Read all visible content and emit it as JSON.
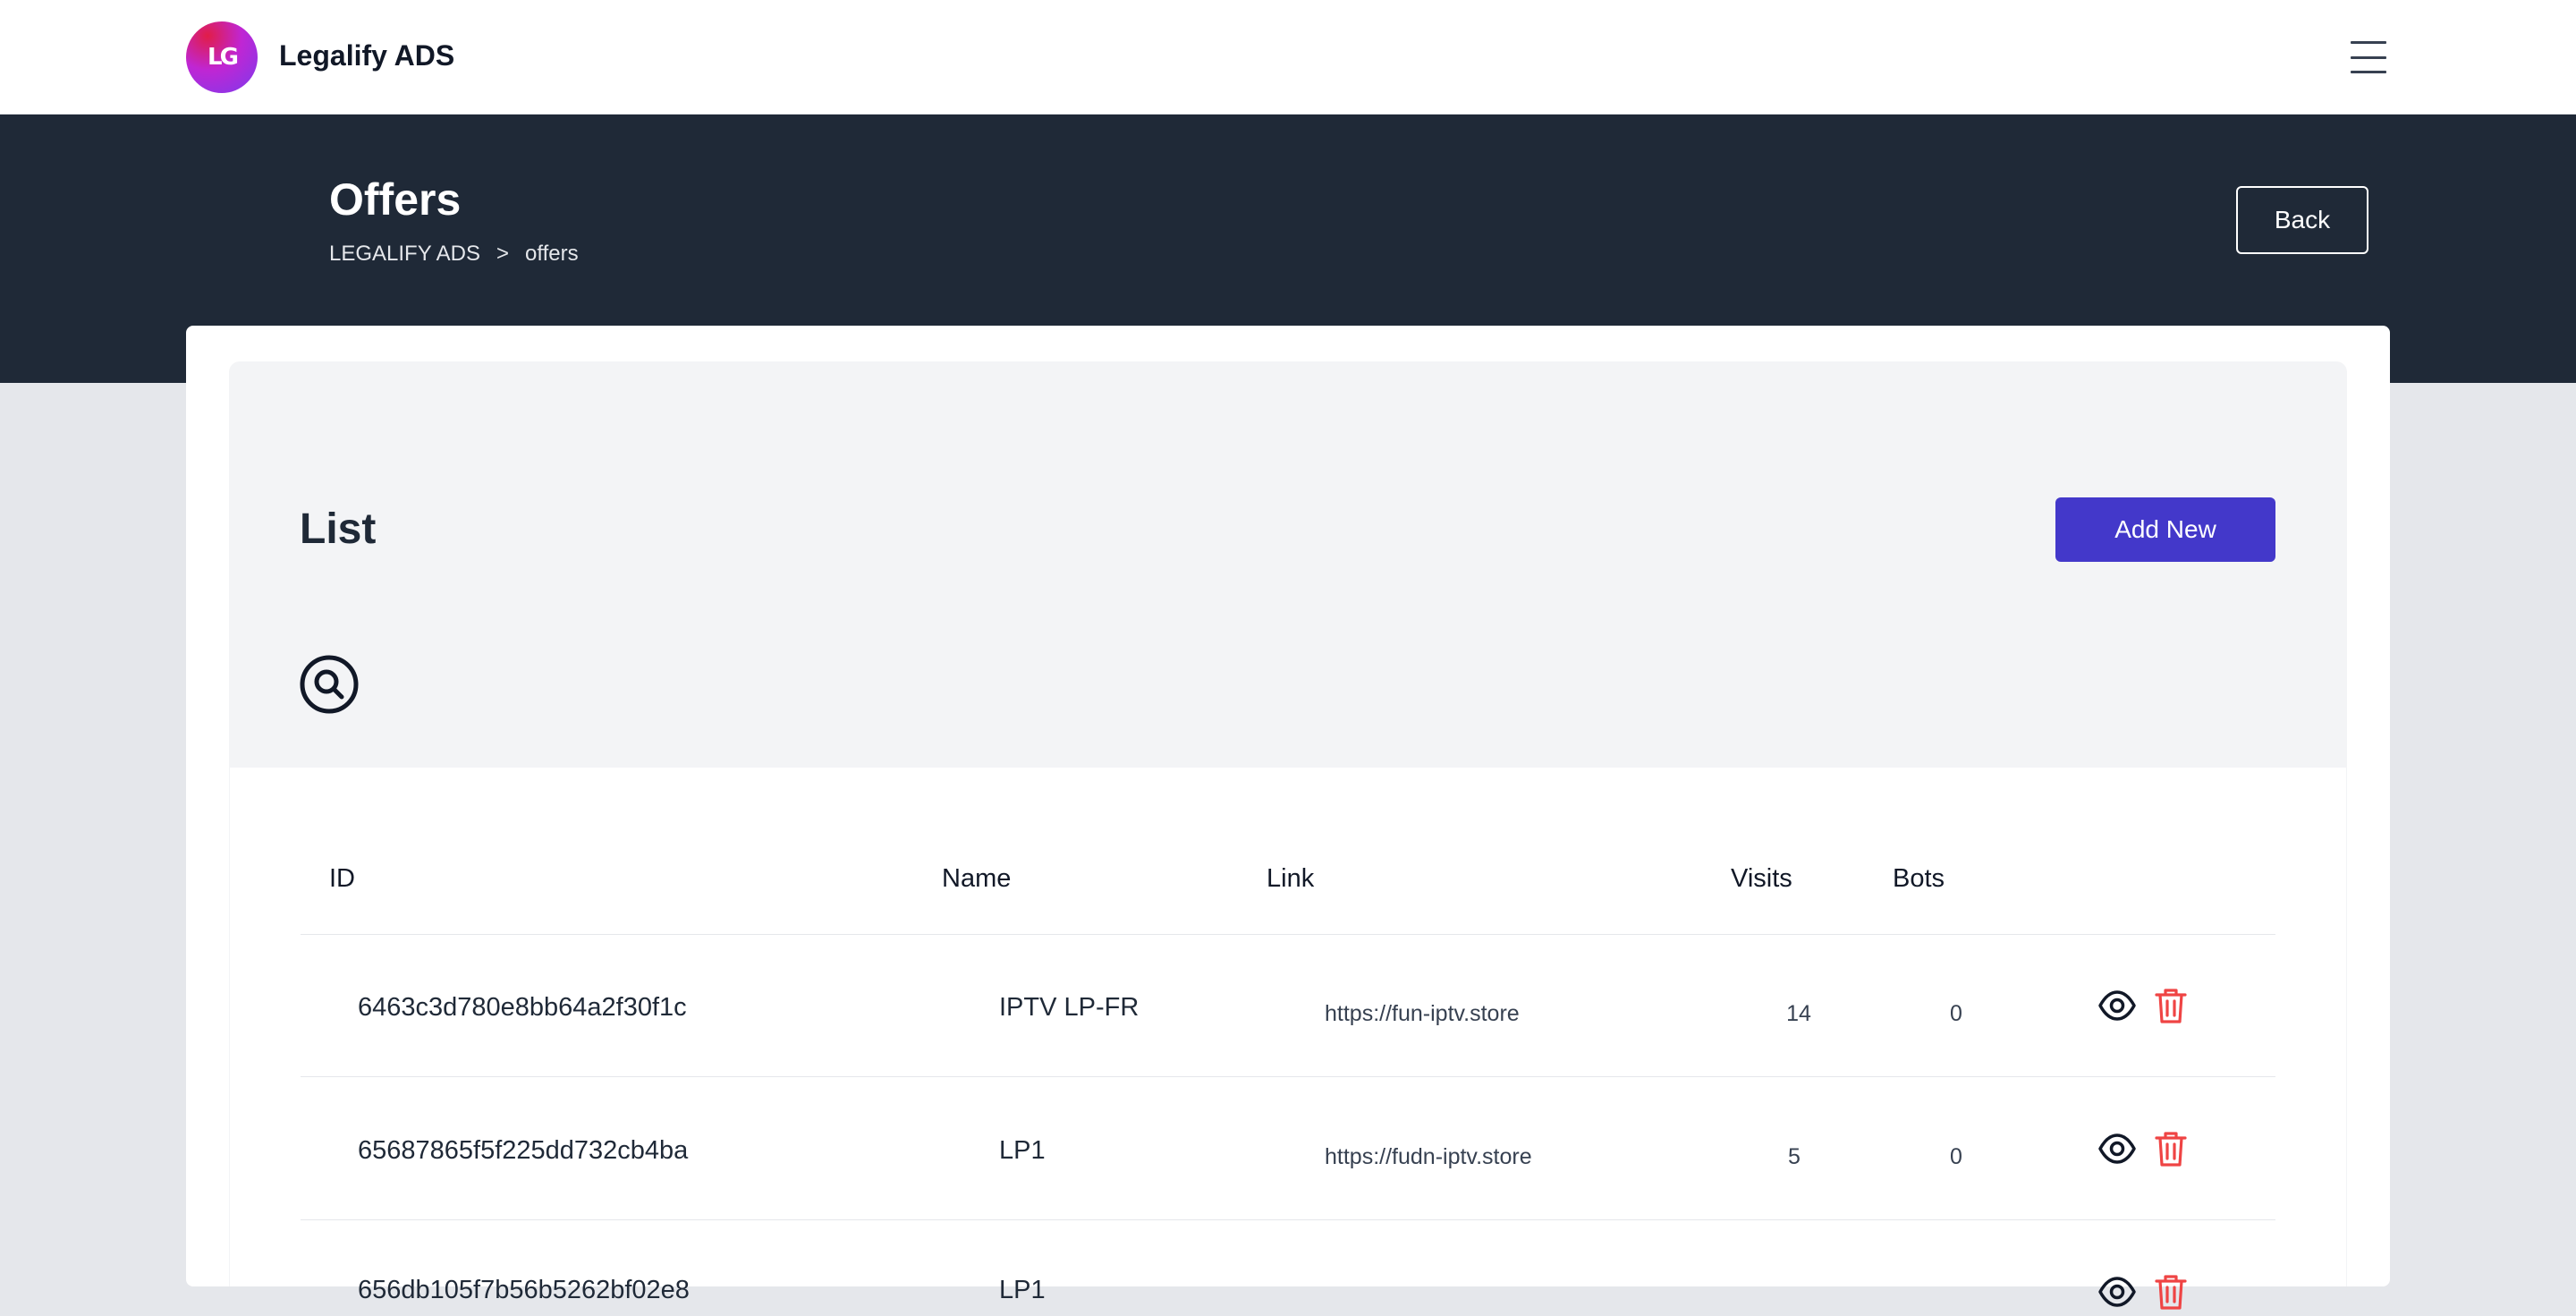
{
  "app": {
    "brand": "Legalify ADS",
    "logo_mark": "LG",
    "accent_color": "#4338ca",
    "header_bg": "#1f2937",
    "danger_color": "#ef4444"
  },
  "header": {
    "title": "Offers",
    "breadcrumb": [
      "LEGALIFY ADS",
      ">",
      "offers"
    ],
    "back_label": "Back"
  },
  "list": {
    "title": "List",
    "add_label": "Add New",
    "search_icon": "search-icon"
  },
  "table": {
    "columns": [
      "ID",
      "Name",
      "Link",
      "Visits",
      "Bots"
    ],
    "rows": [
      {
        "id": "6463c3d780e8bb64a2f30f1c",
        "name": "IPTV LP-FR",
        "link": "https://fun-iptv.store",
        "visits": "14",
        "bots": "0"
      },
      {
        "id": "65687865f5f225dd732cb4ba",
        "name": "LP1",
        "link": "https://fudn-iptv.store",
        "visits": "5",
        "bots": "0"
      },
      {
        "id": "656db105f7b56b5262bf02e8",
        "name": "LP1",
        "link": "",
        "visits": "",
        "bots": ""
      }
    ],
    "row_icons": [
      "eye-icon",
      "trash-icon"
    ]
  }
}
